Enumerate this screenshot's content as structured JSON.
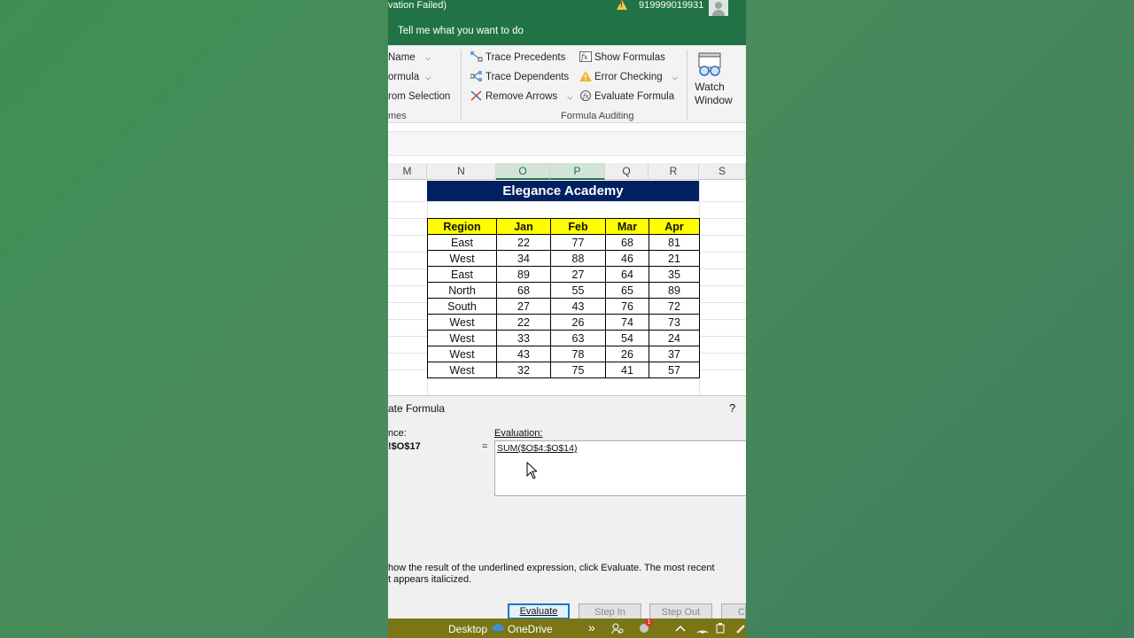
{
  "titlebar": {
    "title_fragment": "vation Failed)",
    "account": "919999019931",
    "tell_me": "Tell me what you want to do"
  },
  "ribbon": {
    "defined_names": {
      "items": [
        "Name",
        "ormula",
        "rom Selection"
      ],
      "label": "mes"
    },
    "formula_auditing": {
      "trace_precedents": "Trace Precedents",
      "trace_dependents": "Trace Dependents",
      "remove_arrows": "Remove Arrows",
      "show_formulas": "Show Formulas",
      "error_checking": "Error Checking",
      "evaluate_formula": "Evaluate Formula",
      "label": "Formula Auditing"
    },
    "watch_window": "Watch Window"
  },
  "sheet": {
    "columns": [
      "M",
      "N",
      "O",
      "P",
      "Q",
      "R",
      "S"
    ],
    "title": "Elegance Academy",
    "headers": [
      "Region",
      "Jan",
      "Feb",
      "Mar",
      "Apr"
    ],
    "rows": [
      [
        "East",
        "22",
        "77",
        "68",
        "81"
      ],
      [
        "West",
        "34",
        "88",
        "46",
        "21"
      ],
      [
        "East",
        "89",
        "27",
        "64",
        "35"
      ],
      [
        "North",
        "68",
        "55",
        "65",
        "89"
      ],
      [
        "South",
        "27",
        "43",
        "76",
        "72"
      ],
      [
        "West",
        "22",
        "26",
        "74",
        "73"
      ],
      [
        "West",
        "33",
        "63",
        "54",
        "24"
      ],
      [
        "West",
        "43",
        "78",
        "26",
        "37"
      ],
      [
        "West",
        "32",
        "75",
        "41",
        "57"
      ]
    ]
  },
  "dialog": {
    "title": "ate Formula",
    "help": "?",
    "reference_label": "nce:",
    "reference_value": "!$O$17",
    "equals": "=",
    "evaluation_label": "Evaluation:",
    "evaluation_value": "SUM($O$4:$O$14)",
    "hint_line1": "how the result of the underlined expression, click Evaluate.  The most recent",
    "hint_line2": "t appears italicized.",
    "buttons": {
      "evaluate": "Evaluate",
      "step_in": "Step In",
      "step_out": "Step Out",
      "close": "C"
    }
  },
  "taskbar": {
    "desktop": "Desktop",
    "onedrive": "OneDrive",
    "chevron": "»",
    "notification_count": "1"
  },
  "colors": {
    "excel_green": "#217346",
    "banner_bg": "#002060",
    "header_bg": "#ffff00",
    "taskbar_bg": "#7a7615"
  }
}
